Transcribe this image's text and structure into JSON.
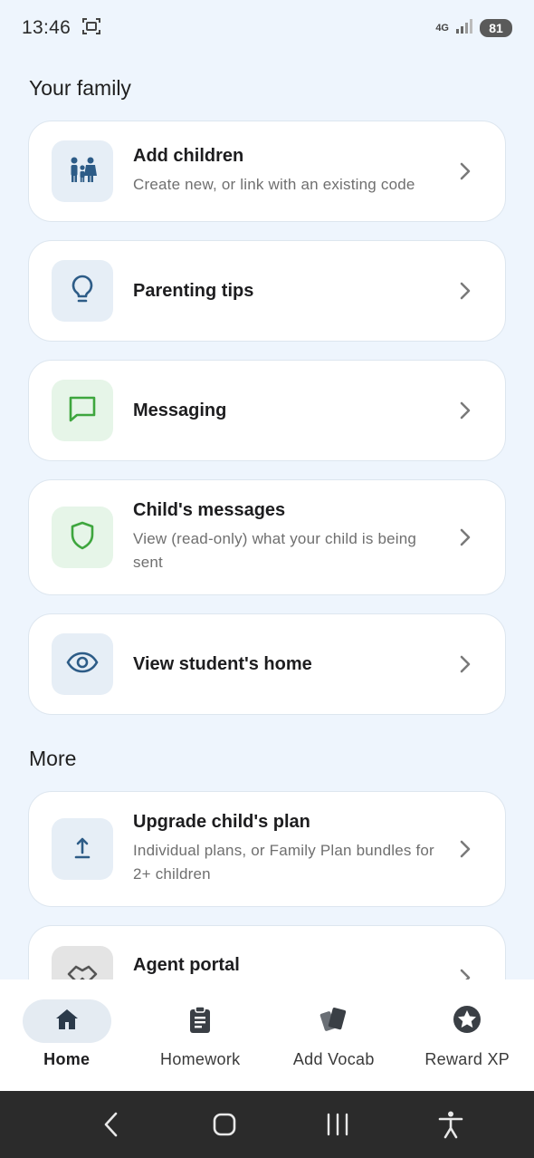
{
  "status_bar": {
    "time": "13:46",
    "network": "4G",
    "battery": "81"
  },
  "sections": {
    "family_title": "Your family",
    "more_title": "More"
  },
  "cards": [
    {
      "title": "Add children",
      "subtitle": "Create new, or link with an existing code",
      "icon": "family-icon"
    },
    {
      "title": "Parenting tips",
      "subtitle": "",
      "icon": "lightbulb-icon"
    },
    {
      "title": "Messaging",
      "subtitle": "",
      "icon": "chat-icon"
    },
    {
      "title": "Child's messages",
      "subtitle": "View (read-only) what your child is being sent",
      "icon": "shield-icon"
    },
    {
      "title": "View student's home",
      "subtitle": "",
      "icon": "eye-icon"
    },
    {
      "title": "Upgrade child's plan",
      "subtitle": "Individual plans, or Family Plan bundles for 2+ children",
      "icon": "upload-arrow-icon"
    },
    {
      "title": "Agent portal",
      "subtitle": "",
      "icon": "handshake-icon"
    }
  ],
  "bottom_nav": [
    {
      "label": "Home",
      "icon": "home-icon",
      "active": true
    },
    {
      "label": "Homework",
      "icon": "clipboard-icon",
      "active": false
    },
    {
      "label": "Add Vocab",
      "icon": "cards-icon",
      "active": false
    },
    {
      "label": "Reward XP",
      "icon": "star-icon",
      "active": false
    }
  ],
  "colors": {
    "background": "#eef5fd",
    "icon_blue": "#2d5c87",
    "icon_green": "#3ea63e"
  }
}
